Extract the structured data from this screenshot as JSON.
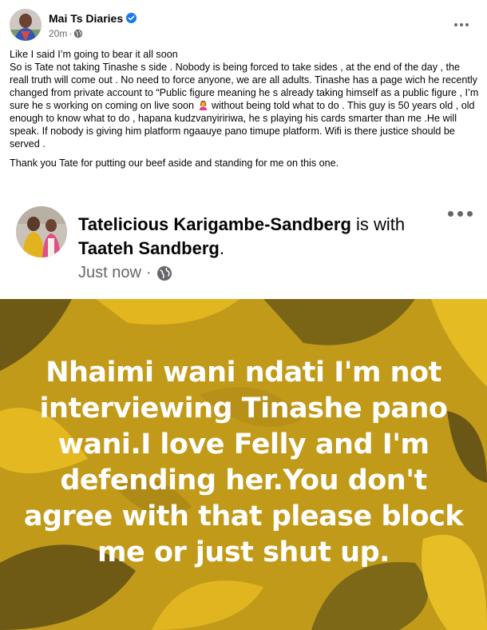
{
  "post": {
    "author": "Mai Ts Diaries",
    "time": "20m",
    "paragraphs": [
      "Like I said I’m going to bear it all soon",
      "So is Tate not taking Tinashe s side . Nobody is being forced to take sides , at the end of the day , the reall truth will come out . No need to force anyone, we are all adults. Tinashe has a page wich he recently changed from private account to “Public figure meaning he s already taking himself as a public figure , I’m sure he s working on coming on live soon",
      "without being told what to do . This guy is 50 years old , old enough to know what to do , hapana kudzvanyiririwa, he s playing his cards smarter than me .He will speak. If nobody is giving him platform ngaauye pano timupe platform. Wifi is there justice should be served .",
      "Thank you Tate for putting our beef aside and standing for  me on this one."
    ]
  },
  "shared": {
    "author": "Tatelicious Karigambe-Sandberg",
    "is_with_text": "is with",
    "tagged": "Taateh Sandberg",
    "period": ".",
    "time": "Just now",
    "status_text": "Nhaimi wani ndati I'm not interviewing Tinashe pano wani.I love Felly and I'm defending her.You don't agree with that please block me or just shut up."
  },
  "icons": {
    "verified": "verified-badge-icon",
    "globe": "globe-icon",
    "more": "more-options-icon",
    "emoji": "woman-gesturing-emoji"
  },
  "colors": {
    "accent": "#1877f2",
    "secondary_text": "#65676b",
    "status_background": "#c29a19"
  }
}
